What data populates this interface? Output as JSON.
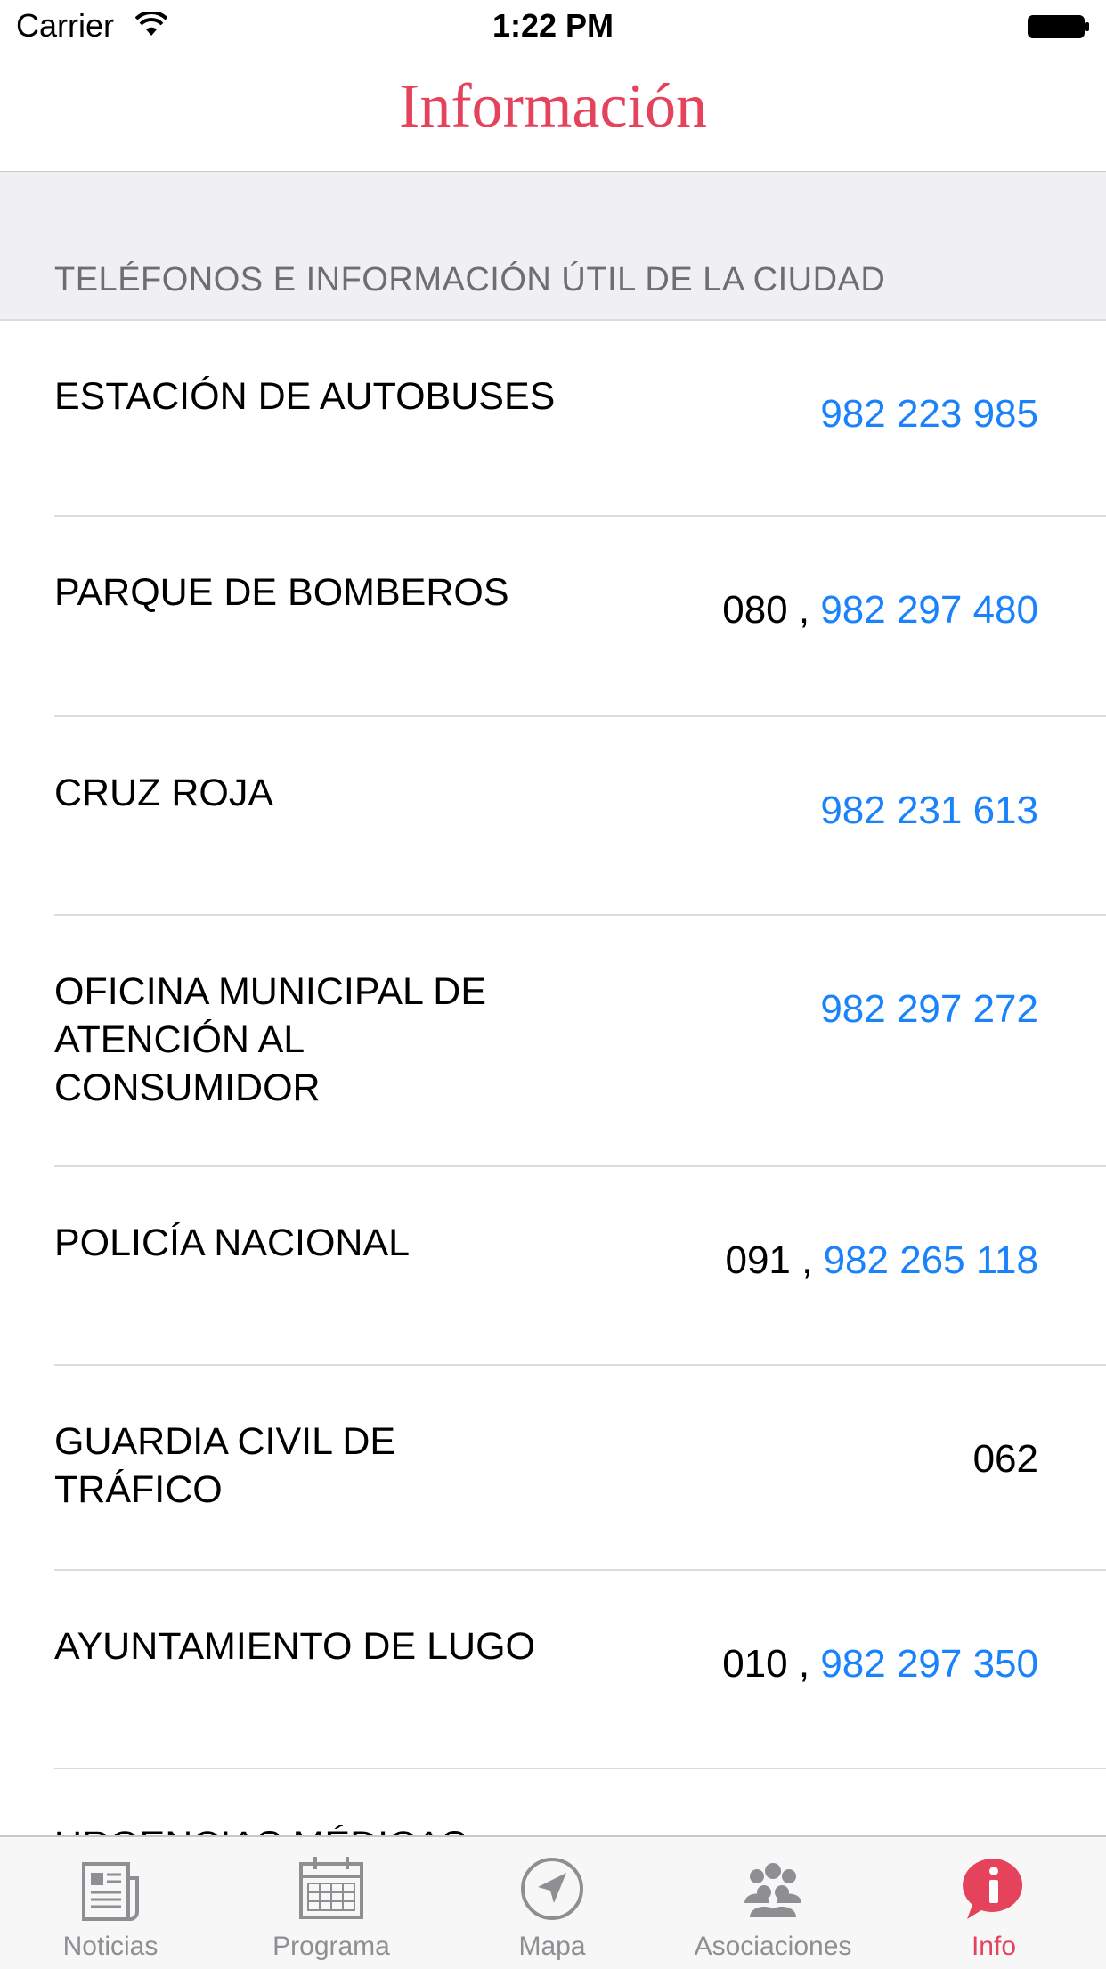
{
  "status_bar": {
    "carrier": "Carrier",
    "time": "1:22 PM"
  },
  "nav": {
    "title": "Información"
  },
  "section": {
    "header": "TELÉFONOS E INFORMACIÓN ÚTIL DE LA CIUDAD"
  },
  "rows": [
    {
      "name": "ESTACIÓN DE AUTOBUSES",
      "prefix": "",
      "phone": "982 223 985"
    },
    {
      "name": "PARQUE DE BOMBEROS",
      "prefix": "080 , ",
      "phone": "982 297 480"
    },
    {
      "name": "CRUZ ROJA",
      "prefix": "",
      "phone": "982 231 613"
    },
    {
      "name": "OFICINA MUNICIPAL DE ATENCIÓN AL CONSUMIDOR",
      "prefix": "",
      "phone": "982 297 272"
    },
    {
      "name": "POLICÍA NACIONAL",
      "prefix": "091 , ",
      "phone": "982 265 118"
    },
    {
      "name": "GUARDIA CIVIL DE TRÁFICO",
      "prefix": "062",
      "phone": ""
    },
    {
      "name": "AYUNTAMIENTO DE LUGO",
      "prefix": "010 , ",
      "phone": "982 297 350"
    },
    {
      "name": "URGENCIAS MÉDICAS",
      "prefix": "",
      "phone": ""
    }
  ],
  "tabs": [
    {
      "label": "Noticias",
      "icon": "newspaper-icon",
      "active": false
    },
    {
      "label": "Programa",
      "icon": "calendar-icon",
      "active": false
    },
    {
      "label": "Mapa",
      "icon": "location-arrow-icon",
      "active": false
    },
    {
      "label": "Asociaciones",
      "icon": "people-icon",
      "active": false
    },
    {
      "label": "Info",
      "icon": "info-bubble-icon",
      "active": true
    }
  ],
  "colors": {
    "accent": "#e5425b",
    "link": "#1a82fb",
    "tab_inactive": "#8e8e93"
  }
}
